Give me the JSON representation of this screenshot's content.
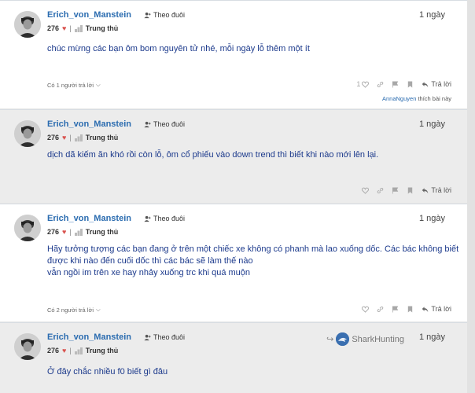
{
  "common": {
    "author": "Erich_von_Manstein",
    "follow_label": "Theo đuôi",
    "score": "276",
    "separator": "|",
    "rank": "Trung thủ",
    "reply_label": "Trả lời",
    "heart_glyph": "♥"
  },
  "posts": [
    {
      "time": "1 ngày",
      "text": "chúc mừng các bạn ôm bom nguyên tử nhé, mỗi ngày lỗ thêm một ít",
      "replies_label": "Có 1 người trả lời",
      "like_count": "1",
      "liked_by": {
        "user": "AnnaNguyen",
        "suffix": "thích bài này"
      }
    },
    {
      "time": "1 ngày",
      "text": "dịch dã kiếm ăn khó rồi còn lỗ, ôm cổ phiếu vào down trend thì biết khi nào mới lên lại."
    },
    {
      "time": "1 ngày",
      "text_lines": [
        "Hãy tưởng tượng các bạn đang ở trên một chiếc xe không có phanh mà lao xuống dốc. Các bác không biết",
        "được khi nào đến cuối dốc thì các bác sẽ làm thế nào",
        "vẫn ngồi im trên xe hay nhảy xuống trc khi quá muộn"
      ],
      "replies_label": "Có 2 người trả lời"
    },
    {
      "time": "1 ngày",
      "text": "Ở đây chắc nhiều f0 biết gì đâu",
      "shared_from": "SharkHunting"
    }
  ],
  "colors": {
    "author": "#2b6cb0",
    "body_text": "#1c3a8c",
    "heart": "#d9534f",
    "post_bg_white": "#ffffff",
    "post_bg_gray": "#ececec"
  }
}
